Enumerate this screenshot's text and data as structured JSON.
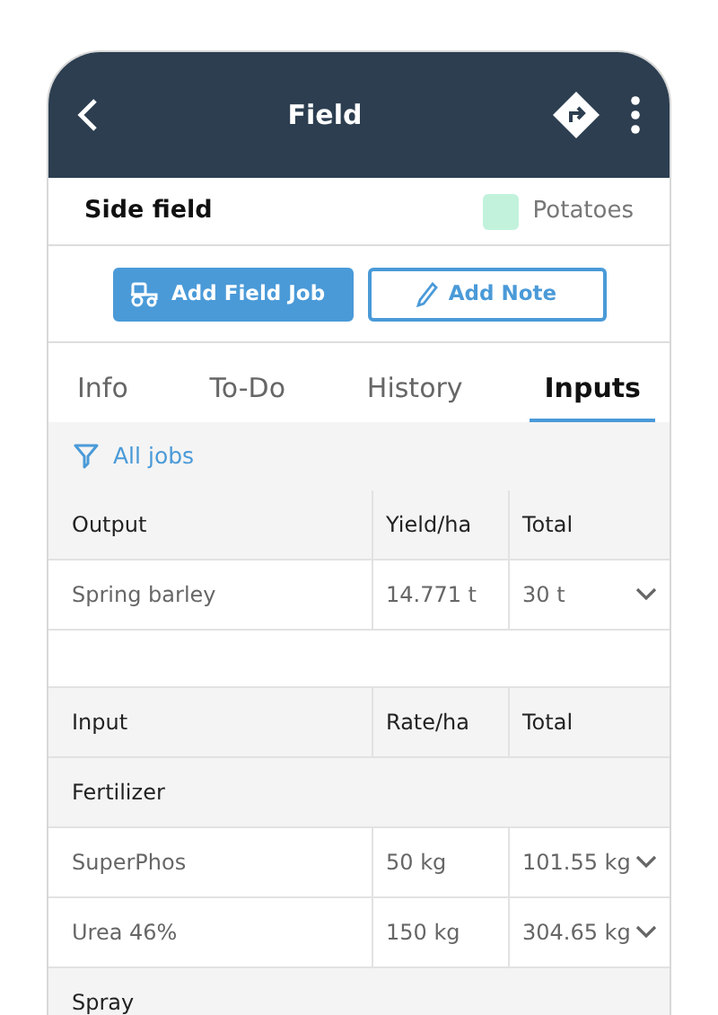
{
  "header": {
    "title": "Field"
  },
  "field": {
    "name": "Side field",
    "crop": {
      "label": "Potatoes",
      "color": "#c2f2dc"
    }
  },
  "buttons": [
    {
      "label": "Add Field Job",
      "kind": "primary"
    },
    {
      "label": "Add Note",
      "kind": "outline"
    }
  ],
  "tabs": [
    {
      "label": "Info",
      "selected": false
    },
    {
      "label": "To-Do",
      "selected": false
    },
    {
      "label": "History",
      "selected": false
    },
    {
      "label": "Inputs",
      "selected": true
    }
  ],
  "filter": {
    "label": "All jobs"
  },
  "output_table": {
    "columns": [
      "Output",
      "Yield/ha",
      "Total"
    ],
    "rows": [
      [
        "Spring barley",
        "14.771 t",
        "30 t"
      ]
    ]
  },
  "input_table": {
    "columns": [
      "Input",
      "Rate/ha",
      "Total"
    ],
    "groups": [
      {
        "name": "Fertilizer",
        "rows": [
          [
            "SuperPhos",
            "50 kg",
            "101.55 kg"
          ],
          [
            "Urea 46%",
            "150 kg",
            "304.65 kg"
          ]
        ]
      },
      {
        "name": "Spray"
      }
    ]
  }
}
